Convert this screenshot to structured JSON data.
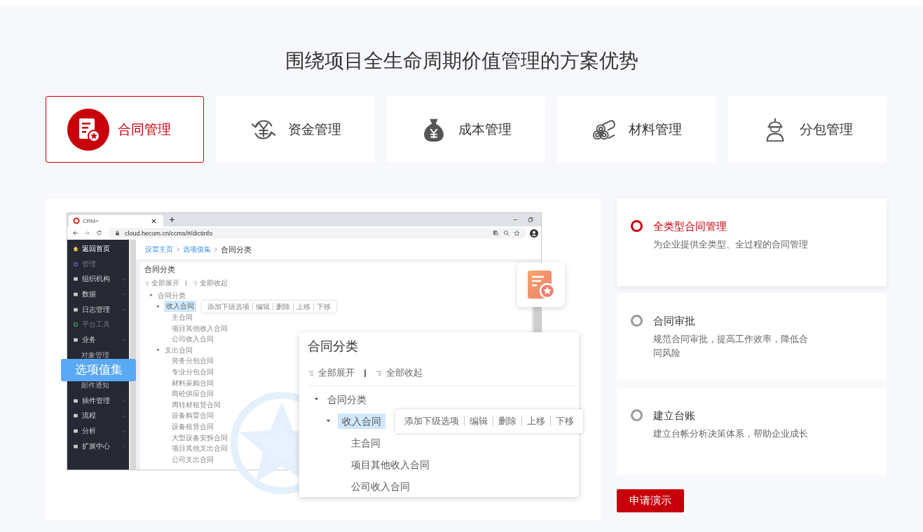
{
  "title": "围绕项目全生命周期价值管理的方案优势",
  "tabs": [
    {
      "label": "合同管理",
      "kind": "contract",
      "selected": true
    },
    {
      "label": "资金管理",
      "kind": "funds",
      "selected": false
    },
    {
      "label": "成本管理",
      "kind": "cost",
      "selected": false
    },
    {
      "label": "材料管理",
      "kind": "material",
      "selected": false
    },
    {
      "label": "分包管理",
      "kind": "subcontract",
      "selected": false
    }
  ],
  "preview": {
    "browser": {
      "tab_title": "CRM+",
      "url": "cloud.hecom.cn/ccms/#/dictinfo"
    },
    "sidebar": [
      {
        "label": "返回首页",
        "kind": "home"
      },
      {
        "label": "管理",
        "kind": "section",
        "color": "#7b5cc4"
      },
      {
        "label": "组织机构",
        "kind": "group"
      },
      {
        "label": "数据",
        "kind": "group"
      },
      {
        "label": "日志管理",
        "kind": "group"
      },
      {
        "label": "平台工具",
        "kind": "section",
        "color": "#3aa64a"
      },
      {
        "label": "业务",
        "kind": "group"
      },
      {
        "label": "对象管理",
        "kind": "sub"
      },
      {
        "label": "选项值集",
        "kind": "badge"
      },
      {
        "label": "邮件通知",
        "kind": "sub"
      },
      {
        "label": "插件管理",
        "kind": "group"
      },
      {
        "label": "流程",
        "kind": "group"
      },
      {
        "label": "分析",
        "kind": "group"
      },
      {
        "label": "扩展中心",
        "kind": "group"
      }
    ],
    "breadcrumb": [
      {
        "label": "设置主页",
        "current": false
      },
      {
        "label": "选项值集",
        "current": false
      },
      {
        "label": "合同分类",
        "current": true
      }
    ],
    "card": {
      "title": "合同分类",
      "toolbar": [
        "全部展开",
        "全部收起"
      ],
      "actions": [
        "添加下级选项",
        "编辑",
        "删除",
        "上移",
        "下移"
      ],
      "tree": [
        {
          "label": "合同分类",
          "selected": false,
          "expanded": true,
          "children": [
            {
              "label": "收入合同",
              "selected": true,
              "expanded": true,
              "children": [
                {
                  "label": "主合同",
                  "selected": false
                },
                {
                  "label": "项目其他收入合同",
                  "selected": false
                },
                {
                  "label": "公司收入合同",
                  "selected": false
                }
              ]
            },
            {
              "label": "支出合同",
              "selected": false,
              "expanded": true,
              "children": [
                {
                  "label": "劳务分包合同",
                  "selected": false
                },
                {
                  "label": "专业分包合同",
                  "selected": false
                },
                {
                  "label": "材料采购合同",
                  "selected": false
                },
                {
                  "label": "商砼供应合同",
                  "selected": false
                },
                {
                  "label": "周转材租赁合同",
                  "selected": false
                },
                {
                  "label": "设备购置合同",
                  "selected": false
                },
                {
                  "label": "设备租赁合同",
                  "selected": false
                },
                {
                  "label": "大型设备安拆合同",
                  "selected": false
                },
                {
                  "label": "项目其他支出合同",
                  "selected": false
                },
                {
                  "label": "公司支出合同",
                  "selected": false
                }
              ]
            }
          ]
        }
      ]
    },
    "popup": {
      "title": "合同分类",
      "toolbar": [
        "全部展开",
        "全部收起"
      ],
      "actions": [
        "添加下级选项",
        "编辑",
        "删除",
        "上移",
        "下移"
      ],
      "tree": [
        {
          "label": "合同分类",
          "selected": false,
          "expanded": true,
          "children": [
            {
              "label": "收入合同",
              "selected": true,
              "expanded": true,
              "children": [
                {
                  "label": "主合同",
                  "selected": false
                },
                {
                  "label": "项目其他收入合同",
                  "selected": false
                },
                {
                  "label": "公司收入合同",
                  "selected": false
                }
              ]
            }
          ]
        }
      ]
    }
  },
  "features": [
    {
      "title": "全类型合同管理",
      "desc": "为企业提供全类型、全过程的合同管理",
      "selected": true
    },
    {
      "title": "合同审批",
      "desc": "规范合同审批，提高工作效率，降低合同风险",
      "selected": false
    },
    {
      "title": "建立台账",
      "desc": "建立台帐分析决策体系，帮助企业成长",
      "selected": false
    }
  ],
  "button": "申请演示"
}
